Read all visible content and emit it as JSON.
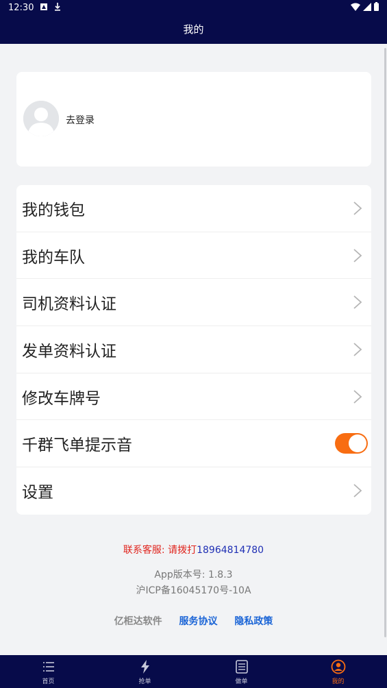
{
  "status_bar": {
    "time": "12:30"
  },
  "header": {
    "title": "我的"
  },
  "profile": {
    "login_text": "去登录"
  },
  "menu": {
    "items": [
      {
        "label": "我的钱包"
      },
      {
        "label": "我的车队"
      },
      {
        "label": "司机资料认证"
      },
      {
        "label": "发单资料认证"
      },
      {
        "label": "修改车牌号"
      },
      {
        "label": "千群飞单提示音",
        "toggle_on": true
      },
      {
        "label": "设置"
      }
    ]
  },
  "footer": {
    "contact_prefix": "联系客服: 请拨打",
    "phone": "18964814780",
    "version": "App版本号: 1.8.3",
    "icp": "沪ICP备16045170号-10A",
    "company": "亿柜达软件",
    "service_agreement": "服务协议",
    "privacy_policy": "隐私政策"
  },
  "tabs": [
    {
      "label": "首页",
      "icon": "list-icon"
    },
    {
      "label": "抢单",
      "icon": "lightning-icon"
    },
    {
      "label": "做单",
      "icon": "document-icon"
    },
    {
      "label": "我的",
      "icon": "user-circle-icon",
      "active": true
    }
  ],
  "colors": {
    "header_bg": "#070b4a",
    "accent": "#f86d12",
    "contact_red": "#e0251e",
    "phone_blue": "#1f2fb4",
    "link_blue": "#1a64d6"
  }
}
